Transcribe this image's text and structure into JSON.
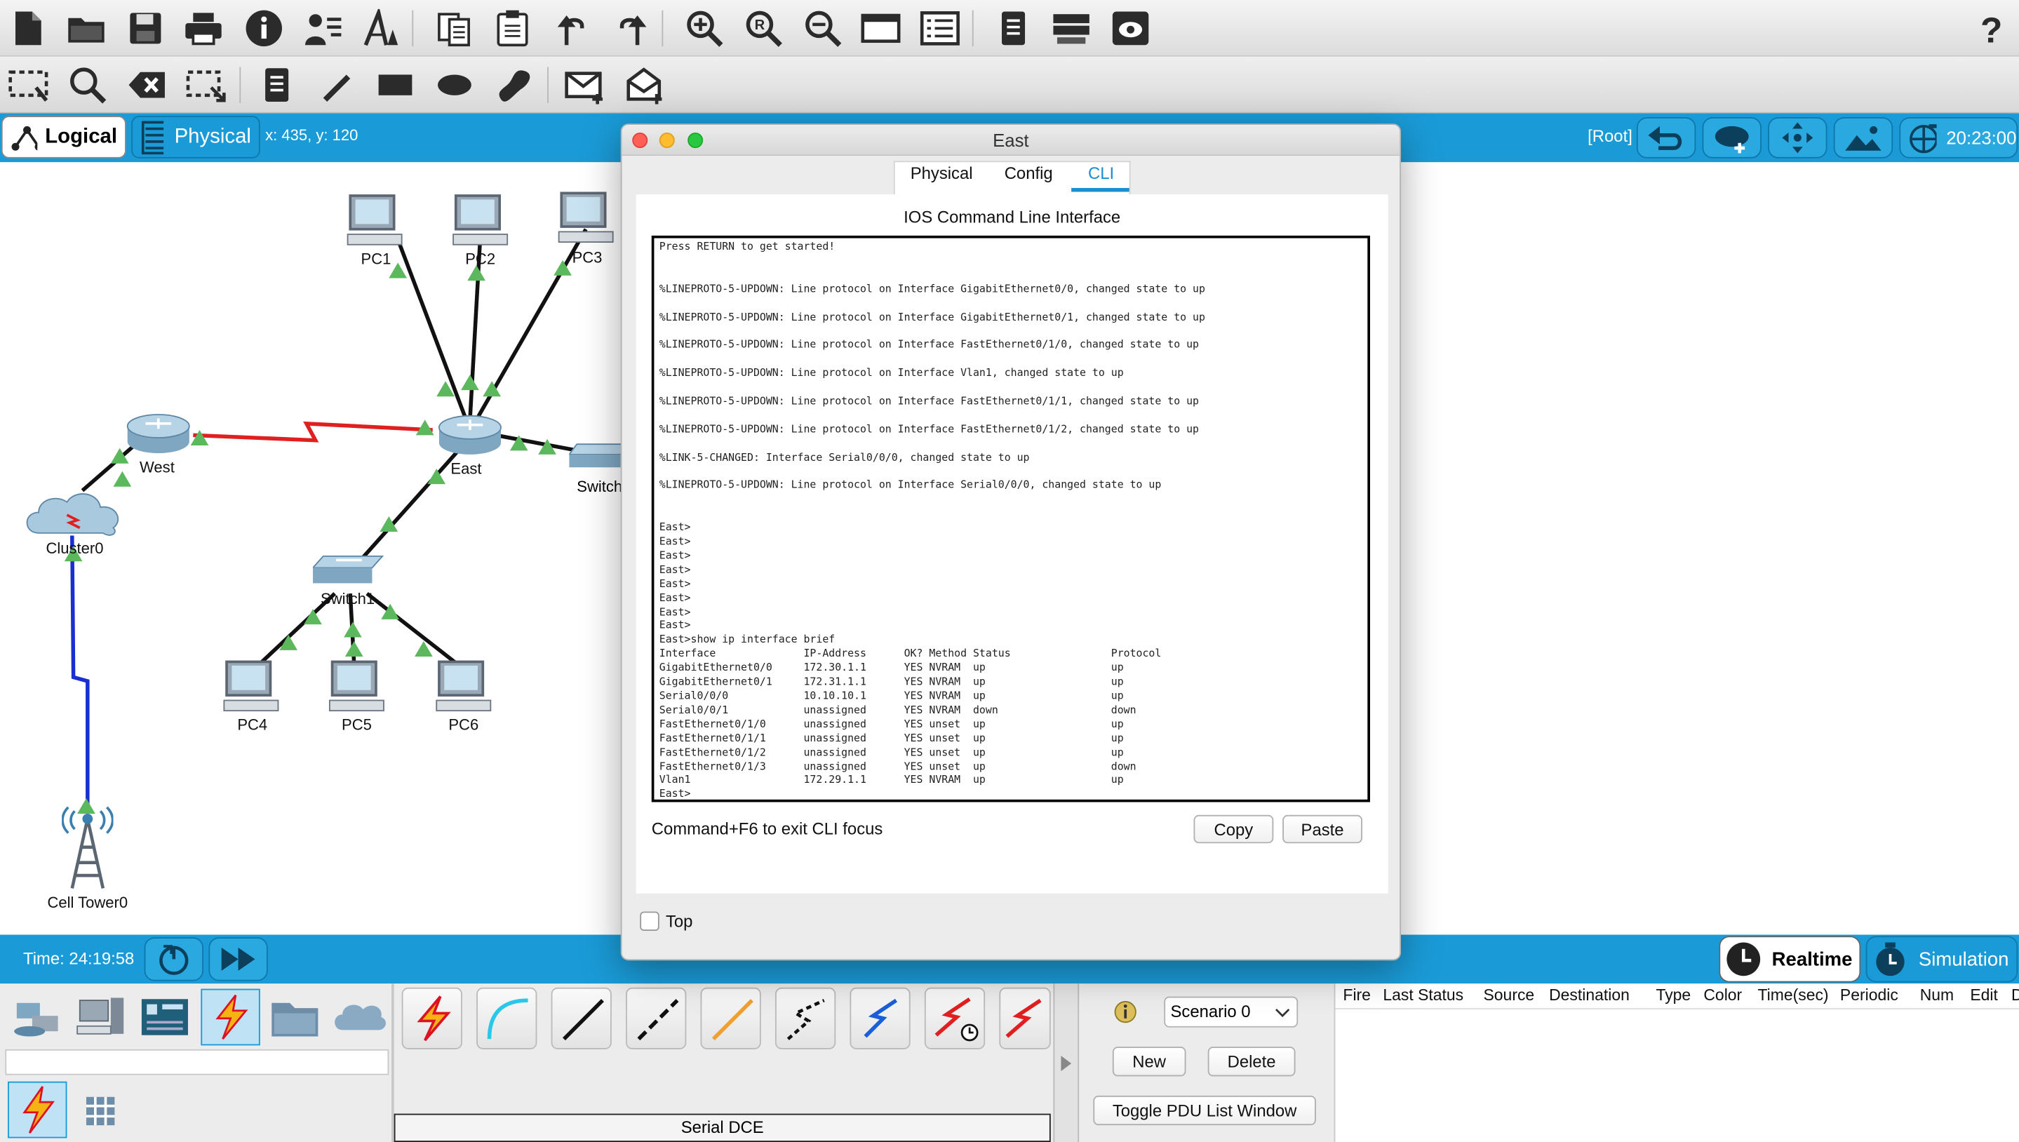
{
  "toolbar": {
    "icons": [
      "new-file-icon",
      "open-folder-icon",
      "save-icon",
      "print-icon",
      "info-icon",
      "activity-wizard-icon",
      "custom-pdu-icon",
      "copy-icon",
      "paste-icon",
      "undo-icon",
      "redo-icon",
      "zoom-in-icon",
      "zoom-reset-icon",
      "zoom-out-icon",
      "drawing-palette-icon",
      "custom-devices-icon",
      "notes-icon",
      "device-list-icon",
      "network-info-icon",
      "help-icon"
    ],
    "tools": [
      "select-icon",
      "inspect-icon",
      "delete-icon",
      "resize-icon",
      "note-icon",
      "pencil-icon",
      "rectangle-icon",
      "ellipse-icon",
      "freeform-icon",
      "simple-pdu-icon",
      "complex-pdu-icon"
    ]
  },
  "modebar": {
    "logical_label": "Logical",
    "physical_label": "Physical",
    "coords": "x: 435, y: 120",
    "root_label": "[Root]",
    "clock": "20:23:00"
  },
  "topology": {
    "devices": {
      "pc1": "PC1",
      "pc2": "PC2",
      "pc3": "PC3",
      "west": "West",
      "east": "East",
      "switch0": "Switch",
      "cluster": "Cluster0",
      "switch1": "Switch1",
      "pc4": "PC4",
      "pc5": "PC5",
      "pc6": "PC6",
      "tower": "Cell Tower0"
    }
  },
  "dialog": {
    "title": "East",
    "tabs": [
      "Physical",
      "Config",
      "CLI"
    ],
    "active_tab": "CLI",
    "heading": "IOS Command Line Interface",
    "cli_lines": [
      "Press RETURN to get started!",
      "",
      "",
      "%LINEPROTO-5-UPDOWN: Line protocol on Interface GigabitEthernet0/0, changed state to up",
      "",
      "%LINEPROTO-5-UPDOWN: Line protocol on Interface GigabitEthernet0/1, changed state to up",
      "",
      "%LINEPROTO-5-UPDOWN: Line protocol on Interface FastEthernet0/1/0, changed state to up",
      "",
      "%LINEPROTO-5-UPDOWN: Line protocol on Interface Vlan1, changed state to up",
      "",
      "%LINEPROTO-5-UPDOWN: Line protocol on Interface FastEthernet0/1/1, changed state to up",
      "",
      "%LINEPROTO-5-UPDOWN: Line protocol on Interface FastEthernet0/1/2, changed state to up",
      "",
      "%LINK-5-CHANGED: Interface Serial0/0/0, changed state to up",
      "",
      "%LINEPROTO-5-UPDOWN: Line protocol on Interface Serial0/0/0, changed state to up",
      "",
      "",
      "East>",
      "East>",
      "East>",
      "East>",
      "East>",
      "East>",
      "East>",
      "East>",
      "East>show ip interface brief",
      "Interface              IP-Address      OK? Method Status                Protocol",
      "GigabitEthernet0/0     172.30.1.1      YES NVRAM  up                    up",
      "GigabitEthernet0/1     172.31.1.1      YES NVRAM  up                    up",
      "Serial0/0/0            10.10.10.1      YES NVRAM  up                    up",
      "Serial0/0/1            unassigned      YES NVRAM  down                  down",
      "FastEthernet0/1/0      unassigned      YES unset  up                    up",
      "FastEthernet0/1/1      unassigned      YES unset  up                    up",
      "FastEthernet0/1/2      unassigned      YES unset  up                    up",
      "FastEthernet0/1/3      unassigned      YES unset  up                    down",
      "Vlan1                  172.29.1.1      YES NVRAM  up                    up",
      "East>"
    ],
    "hint": "Command+F6 to exit CLI focus",
    "copy_label": "Copy",
    "paste_label": "Paste",
    "top_label": "Top",
    "top_checked": false
  },
  "timebar": {
    "time": "Time: 24:19:58",
    "realtime_label": "Realtime",
    "simulation_label": "Simulation"
  },
  "bottom": {
    "categories": [
      "network-devices-icon",
      "end-devices-icon",
      "components-icon",
      "connections-icon",
      "miscellaneous-icon",
      "multiuser-icon"
    ],
    "selected_category": "connections-icon",
    "connection_types": [
      "automatic-connection-icon",
      "console-cable-icon",
      "copper-straight-icon",
      "copper-cross-icon",
      "fiber-icon",
      "phone-cable-icon",
      "coaxial-cable-icon",
      "serial-dce-icon",
      "serial-dte-icon"
    ],
    "selected_connection_label": "Serial DCE",
    "scenario": "Scenario 0",
    "new_label": "New",
    "delete_label": "Delete",
    "toggle_label": "Toggle PDU List Window",
    "pdu_headers": [
      "Fire",
      "Last Status",
      "Source",
      "Destination",
      "Type",
      "Color",
      "Time(sec)",
      "Periodic",
      "Num",
      "Edit",
      "D"
    ]
  },
  "colors": {
    "accent": "#1a9bd7",
    "serial_link": "#e02020",
    "wireless_link": "#1a2fd0",
    "link_up": "#5cb85c"
  }
}
